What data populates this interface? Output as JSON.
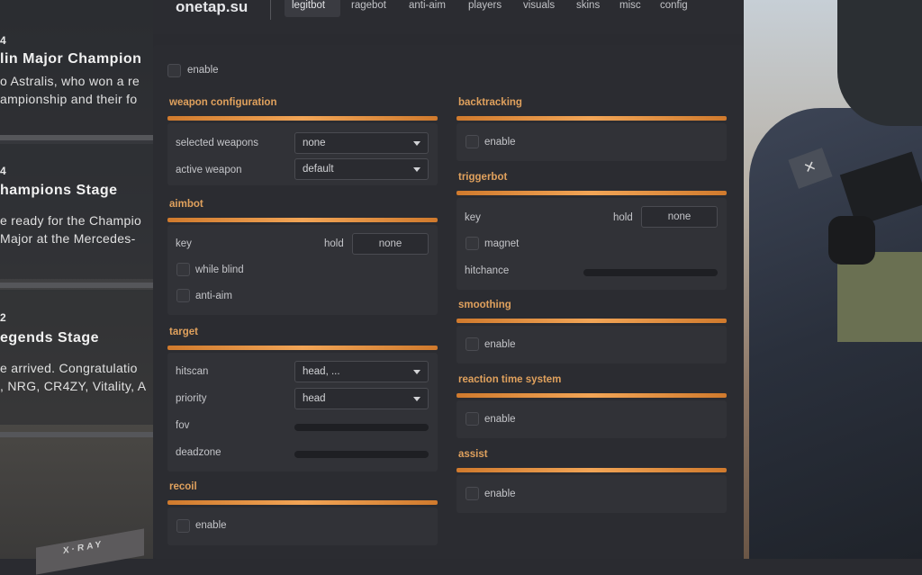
{
  "topbar": {
    "brand": "onetap.su",
    "tabs": [
      {
        "label": "legitbot",
        "active": true
      },
      {
        "label": "ragebot",
        "active": false
      },
      {
        "label": "anti-aim",
        "active": false
      },
      {
        "label": "players",
        "active": false
      },
      {
        "label": "visuals",
        "active": false
      },
      {
        "label": "skins",
        "active": false
      },
      {
        "label": "misc",
        "active": false
      },
      {
        "label": "config",
        "active": false
      }
    ]
  },
  "panel": {
    "enable_label": "enable",
    "weapon_configuration": {
      "title": "weapon configuration",
      "selected_weapons_label": "selected weapons",
      "selected_weapons_value": "none",
      "active_weapon_label": "active weapon",
      "active_weapon_value": "default"
    },
    "aimbot": {
      "title": "aimbot",
      "key_label": "key",
      "key_mode": "hold",
      "key_value": "none",
      "while_blind_label": "while blind",
      "anti_aim_label": "anti-aim"
    },
    "target": {
      "title": "target",
      "hitscan_label": "hitscan",
      "hitscan_value": "head, ...",
      "priority_label": "priority",
      "priority_value": "head",
      "fov_label": "fov",
      "deadzone_label": "deadzone"
    },
    "recoil": {
      "title": "recoil",
      "enable_label": "enable"
    },
    "backtracking": {
      "title": "backtracking",
      "enable_label": "enable"
    },
    "triggerbot": {
      "title": "triggerbot",
      "key_label": "key",
      "key_mode": "hold",
      "key_value": "none",
      "magnet_label": "magnet",
      "hitchance_label": "hitchance"
    },
    "smoothing": {
      "title": "smoothing",
      "enable_label": "enable"
    },
    "reaction_time_system": {
      "title": "reaction time system",
      "enable_label": "enable"
    },
    "assist": {
      "title": "assist",
      "enable_label": "enable"
    }
  },
  "background": {
    "news": [
      {
        "num": "4",
        "title": "lin Major Champion",
        "lines": [
          "o Astralis, who won a re",
          "ampionship and their fo"
        ]
      },
      {
        "num": "4",
        "title": "hampions Stage",
        "lines": [
          "e ready for the Champio",
          " Major at the Mercedes-"
        ]
      },
      {
        "num": "2",
        "title": "egends Stage",
        "lines": [
          "e arrived. Congratulatio",
          ", NRG, CR4ZY, Vitality, A"
        ]
      }
    ],
    "tag_text": "X·RAY"
  },
  "colors": {
    "accent": "#f2a556",
    "panel": "#2b2c31",
    "group": "#313237"
  }
}
